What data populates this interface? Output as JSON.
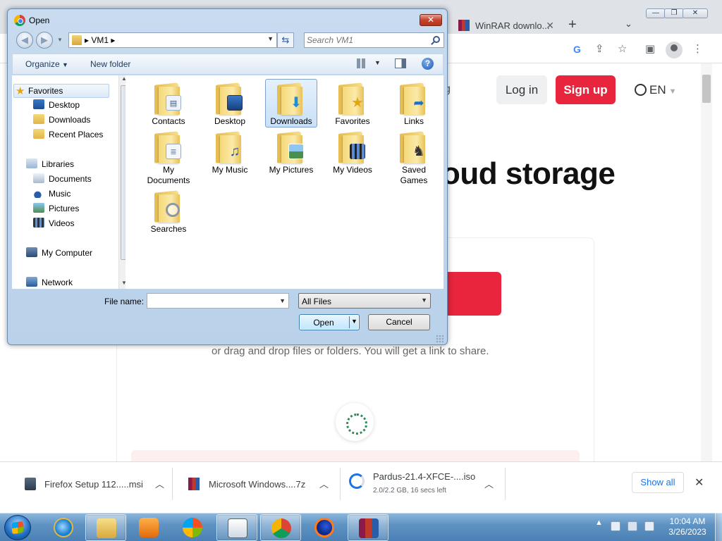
{
  "browser": {
    "tab": {
      "title": "WinRAR downlo..."
    },
    "new_tab_symbol": "+",
    "page": {
      "nav_fragment": "g",
      "login_label": "Log in",
      "signup_label": "Sign up",
      "lang_label": "EN",
      "headline": "oud storage",
      "drag_text": "or drag and drop files or folders. You will get a link to share.",
      "accent_color": "#e8253d"
    },
    "downloads": [
      {
        "name": "Firefox Setup 112.....msi",
        "sub": ""
      },
      {
        "name": "Microsoft Windows....7z",
        "sub": ""
      },
      {
        "name": "Pardus-21.4-XFCE-....iso",
        "sub": "2.0/2.2 GB, 16 secs left"
      }
    ],
    "show_all_label": "Show all"
  },
  "dialog": {
    "title": "Open",
    "breadcrumb": "VM1",
    "search_placeholder": "Search VM1",
    "organize_label": "Organize",
    "new_folder_label": "New folder",
    "help_symbol": "?",
    "nav": {
      "favorites": "Favorites",
      "desktop": "Desktop",
      "downloads": "Downloads",
      "recent_places": "Recent Places",
      "libraries": "Libraries",
      "documents": "Documents",
      "music": "Music",
      "pictures": "Pictures",
      "videos": "Videos",
      "my_computer": "My Computer",
      "network": "Network"
    },
    "folders": [
      {
        "label": "Contacts",
        "icon": "contacts-icon"
      },
      {
        "label": "Desktop",
        "icon": "desktop-icon"
      },
      {
        "label": "Downloads",
        "icon": "downloads-icon",
        "selected": true
      },
      {
        "label": "Favorites",
        "icon": "favorites-icon"
      },
      {
        "label": "Links",
        "icon": "links-icon"
      },
      {
        "label": "My Documents",
        "icon": "documents-icon"
      },
      {
        "label": "My Music",
        "icon": "music-icon"
      },
      {
        "label": "My Pictures",
        "icon": "pictures-icon"
      },
      {
        "label": "My Videos",
        "icon": "videos-icon"
      },
      {
        "label": "Saved Games",
        "icon": "games-icon"
      },
      {
        "label": "Searches",
        "icon": "searches-icon"
      }
    ],
    "filename_label": "File name:",
    "filename_value": "",
    "filetype_value": "All Files",
    "open_label": "Open",
    "cancel_label": "Cancel"
  },
  "taskbar": {
    "time": "10:04 AM",
    "date": "3/26/2023",
    "pinned": [
      "explorer-icon",
      "media-player-icon",
      "windows-media-center-icon",
      "notepad-icon",
      "chrome-icon",
      "firefox-icon",
      "winrar-icon"
    ]
  }
}
